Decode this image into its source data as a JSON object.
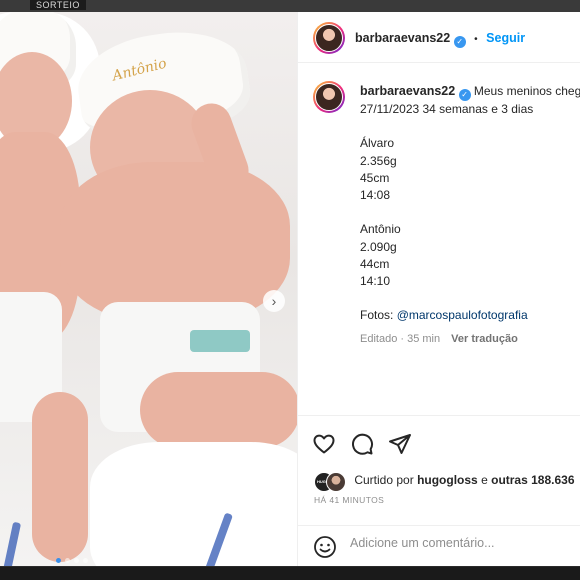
{
  "backdrop": {
    "tag": "SORTEIO"
  },
  "post": {
    "cap_text": "Antônio",
    "carousel": {
      "slides": 4,
      "active": 0
    }
  },
  "header": {
    "username": "barbaraevans22",
    "follow_label": "Seguir"
  },
  "caption": {
    "username": "barbaraevans22",
    "first_line": "Meus meninos chegaram",
    "lines": [
      "27/11/2023 34 semanas e 3 dias",
      "",
      "Álvaro",
      "2.356g",
      "45cm",
      "14:08",
      "",
      "Antônio",
      "2.090g",
      "44cm",
      "14:10",
      ""
    ],
    "photos_label": "Fotos:",
    "photos_mention": "@marcospaulofotografia",
    "edited": "Editado · 35 min",
    "translate": "Ver tradução"
  },
  "likes": {
    "prefix": "Curtido por",
    "user": "hugogloss",
    "middle": "e",
    "others": "outras 188.636",
    "avatar_text": "HUGO GLOSS"
  },
  "time_ago": "HÁ 41 MINUTOS",
  "comment": {
    "placeholder": "Adicione um comentário..."
  },
  "colors": {
    "accent": "#0095f6",
    "verified": "#3897f0",
    "text": "#262626",
    "muted": "#8e8e8e"
  },
  "icons": [
    "heart-icon",
    "comment-icon",
    "share-icon",
    "verified-badge-icon",
    "smile-icon",
    "chevron-right-icon"
  ]
}
